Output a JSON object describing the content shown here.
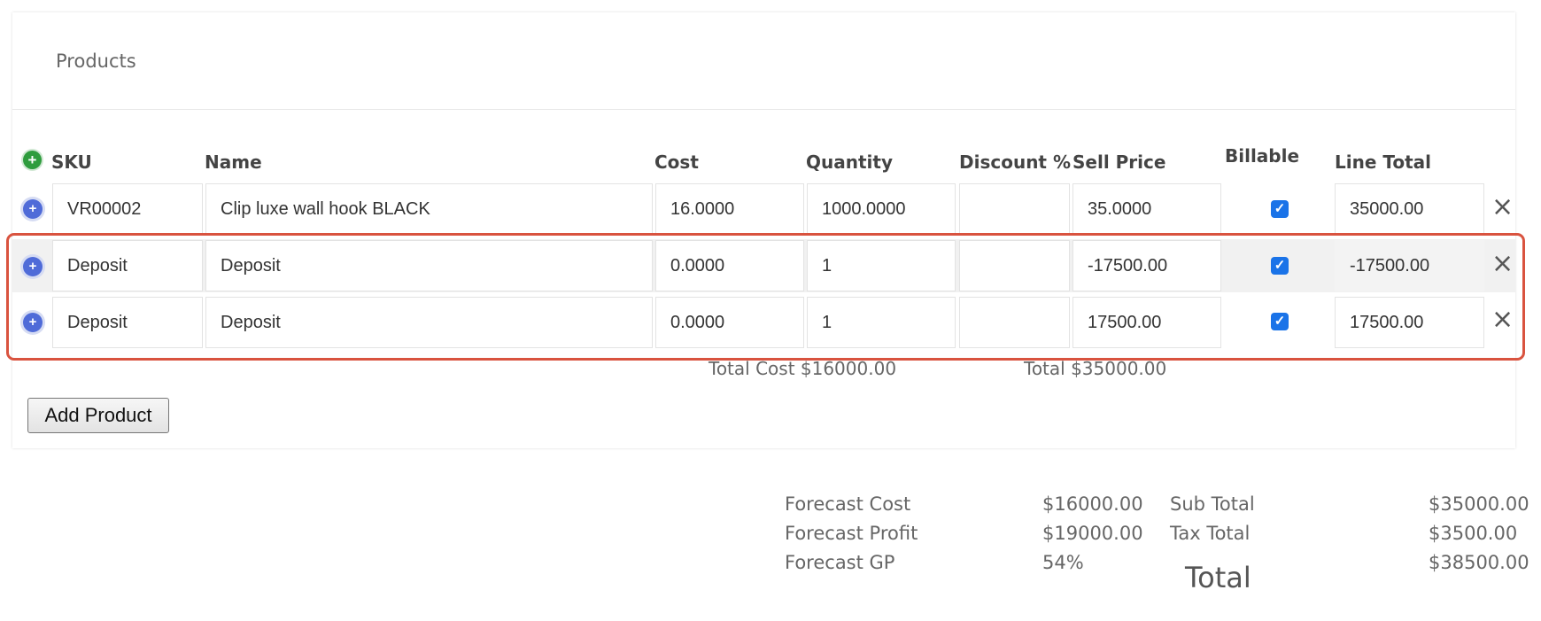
{
  "panel": {
    "title": "Products"
  },
  "columns": {
    "sku": "SKU",
    "name": "Name",
    "cost": "Cost",
    "quantity": "Quantity",
    "discount": "Discount %",
    "sell_price": "Sell Price",
    "billable": "Billable",
    "line_total": "Line Total"
  },
  "rows": [
    {
      "sku": "VR00002",
      "name": "Clip luxe wall hook BLACK",
      "cost": "16.0000",
      "quantity": "1000.0000",
      "discount": "",
      "sell_price": "35.0000",
      "billable": true,
      "line_total": "35000.00"
    },
    {
      "sku": "Deposit",
      "name": "Deposit",
      "cost": "0.0000",
      "quantity": "1",
      "discount": "",
      "sell_price": "-17500.00",
      "billable": true,
      "line_total": "-17500.00"
    },
    {
      "sku": "Deposit",
      "name": "Deposit",
      "cost": "0.0000",
      "quantity": "1",
      "discount": "",
      "sell_price": "17500.00",
      "billable": true,
      "line_total": "17500.00"
    }
  ],
  "totals": {
    "total_cost": "Total Cost $16000.00",
    "total": "Total $35000.00"
  },
  "add_product_label": "Add Product",
  "summary": {
    "forecast_cost_label": "Forecast Cost",
    "forecast_cost_value": "$16000.00",
    "forecast_profit_label": "Forecast Profit",
    "forecast_profit_value": "$19000.00",
    "forecast_gp_label": "Forecast GP",
    "forecast_gp_value": "54%",
    "sub_total_label": "Sub Total",
    "sub_total_value": "$35000.00",
    "tax_total_label": "Tax Total",
    "tax_total_value": "$3500.00",
    "total_label": "Total",
    "total_value": "$38500.00"
  },
  "colors": {
    "highlight": "#d9533f",
    "checkbox": "#1a73e8",
    "add_icon": "#2e9c3d",
    "row_plus_icon": "#4f6bd8"
  },
  "icons": {
    "header_add": "plus-circle-icon",
    "row_add": "plus-circle-icon",
    "row_remove": "close-icon",
    "billable_check": "checkbox-checked-icon"
  }
}
